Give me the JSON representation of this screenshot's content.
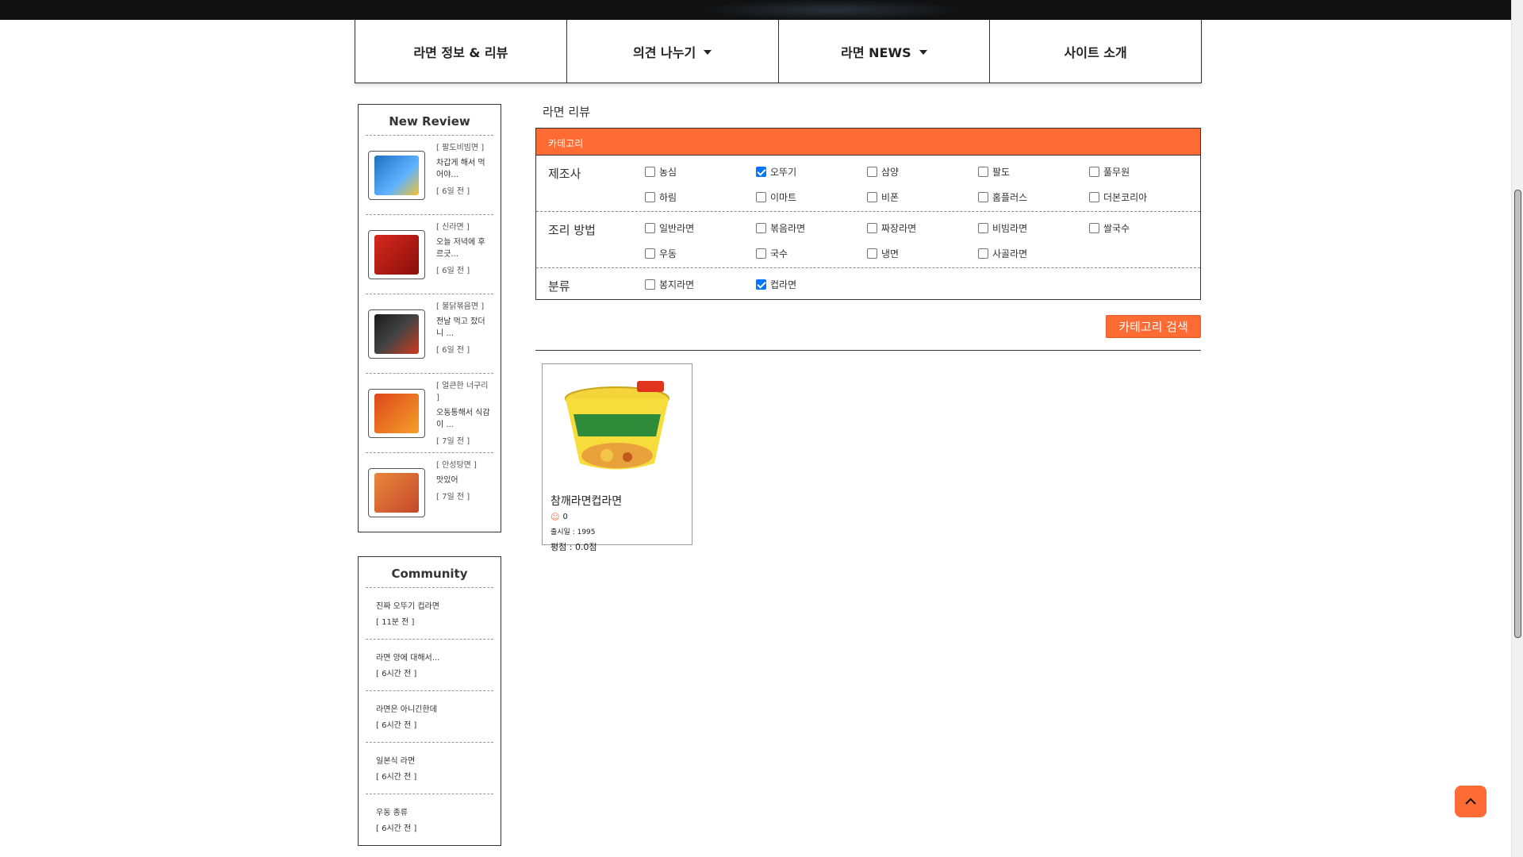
{
  "nav": {
    "items": [
      {
        "label": "라면 정보 & 리뷰",
        "dropdown": false
      },
      {
        "label": "의견 나누기",
        "dropdown": true
      },
      {
        "label": "라면 NEWS",
        "dropdown": true
      },
      {
        "label": "사이트 소개",
        "dropdown": false
      }
    ]
  },
  "new_review": {
    "title": "New Review",
    "items": [
      {
        "category": "[ 팔도비빔면 ]",
        "text": "차갑게 해서 먹어야...",
        "time": "[ 6일 전 ]",
        "color": "#1f6fc2"
      },
      {
        "category": "[ 신라면 ]",
        "text": "오늘 저녁에 후르긋...",
        "time": "[ 6일 전 ]",
        "color": "#d6281f"
      },
      {
        "category": "[ 불닭볶음면 ]",
        "text": "전날 먹고 잤더니 ...",
        "time": "[ 6일 전 ]",
        "color": "#1b1b1b"
      },
      {
        "category": "[ 얼큰한 너구리 ]",
        "text": "오동통해서 식감이 ...",
        "time": "[ 7일 전 ]",
        "color": "#e0461d"
      },
      {
        "category": "[ 안성탕면 ]",
        "text": "맛있어",
        "time": "[ 7일 전 ]",
        "color": "#e9873a"
      }
    ]
  },
  "community": {
    "title": "Community",
    "items": [
      {
        "text": "진짜 오뚜기 컵라면",
        "time": "[ 11분 전 ]"
      },
      {
        "text": "라면 양에 대해서...",
        "time": "[ 6시간 전 ]"
      },
      {
        "text": "라면은 아니긴한데",
        "time": "[ 6시간 전 ]"
      },
      {
        "text": "일본식 라면",
        "time": "[ 6시간 전 ]"
      },
      {
        "text": "우동 종류",
        "time": "[ 6시간 전 ]"
      }
    ]
  },
  "main": {
    "section_title": "라면 리뷰",
    "filter": {
      "header": "카테고리",
      "rows": [
        {
          "label": "제조사",
          "options": [
            {
              "label": "농심",
              "checked": false
            },
            {
              "label": "오뚜기",
              "checked": true
            },
            {
              "label": "삼양",
              "checked": false
            },
            {
              "label": "팔도",
              "checked": false
            },
            {
              "label": "풀무원",
              "checked": false
            },
            {
              "label": "하림",
              "checked": false
            },
            {
              "label": "이마트",
              "checked": false
            },
            {
              "label": "비폰",
              "checked": false
            },
            {
              "label": "홈플러스",
              "checked": false
            },
            {
              "label": "더본코리아",
              "checked": false
            }
          ]
        },
        {
          "label": "조리 방법",
          "options": [
            {
              "label": "일반라면",
              "checked": false
            },
            {
              "label": "볶음라면",
              "checked": false
            },
            {
              "label": "짜장라면",
              "checked": false
            },
            {
              "label": "비빔라면",
              "checked": false
            },
            {
              "label": "쌀국수",
              "checked": false
            },
            {
              "label": "우동",
              "checked": false
            },
            {
              "label": "국수",
              "checked": false
            },
            {
              "label": "냉면",
              "checked": false
            },
            {
              "label": "사골라면",
              "checked": false
            }
          ]
        },
        {
          "label": "분류",
          "options": [
            {
              "label": "봉지라면",
              "checked": false
            },
            {
              "label": "컵라면",
              "checked": true
            }
          ]
        }
      ],
      "search_label": "카테고리 검색"
    },
    "products": [
      {
        "name": "참깨라면컵라면",
        "likes": "0",
        "release": "출시일 : 1995",
        "rating": "평점 : 0.0점"
      }
    ]
  },
  "colors": {
    "accent": "#ff6b35",
    "checkbox": "#0075ff"
  },
  "icons": {
    "to_top": "chevron-up-icon",
    "like": "smile-icon",
    "dropdown": "caret-down-icon"
  }
}
